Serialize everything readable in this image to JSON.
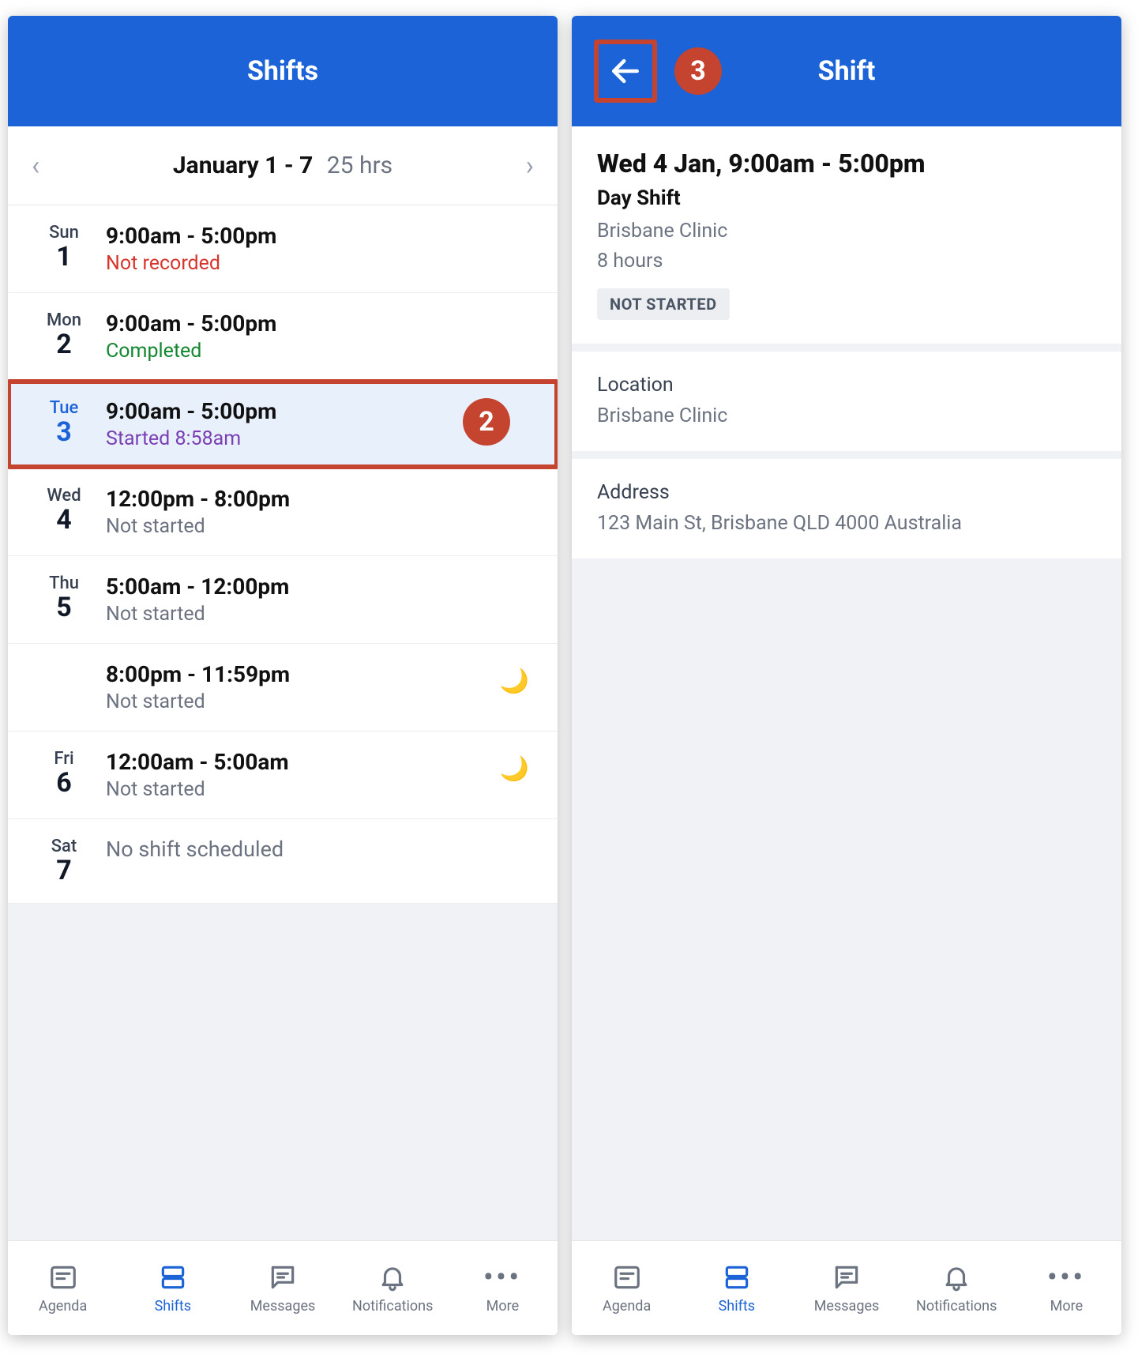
{
  "left": {
    "title": "Shifts",
    "week_range": "January 1 - 7",
    "week_hours": "25 hrs",
    "days": [
      {
        "dow": "Sun",
        "num": "1",
        "time": "9:00am - 5:00pm",
        "status": "Not recorded",
        "status_class": "status-notrecorded"
      },
      {
        "dow": "Mon",
        "num": "2",
        "time": "9:00am - 5:00pm",
        "status": "Completed",
        "status_class": "status-completed"
      },
      {
        "dow": "Tue",
        "num": "3",
        "time": "9:00am - 5:00pm",
        "status": "Started 8:58am",
        "status_class": "status-started",
        "selected": true,
        "callout": "2"
      },
      {
        "dow": "Wed",
        "num": "4",
        "time": "12:00pm - 8:00pm",
        "status": "Not started",
        "status_class": "status-notstarted"
      },
      {
        "dow": "Thu",
        "num": "5",
        "time": "5:00am - 12:00pm",
        "status": "Not started",
        "status_class": "status-notstarted",
        "extra": {
          "time": "8:00pm - 11:59pm",
          "status": "Not started",
          "status_class": "status-notstarted",
          "night": true
        }
      },
      {
        "dow": "Fri",
        "num": "6",
        "time": "12:00am - 5:00am",
        "status": "Not started",
        "status_class": "status-notstarted",
        "night": true
      },
      {
        "dow": "Sat",
        "num": "7",
        "none": "No shift scheduled"
      }
    ]
  },
  "right": {
    "title": "Shift",
    "callout": "3",
    "header": {
      "datetime": "Wed 4 Jan, 9:00am - 5:00pm",
      "name": "Day Shift",
      "location": "Brisbane Clinic",
      "duration": "8 hours",
      "badge": "NOT STARTED"
    },
    "location_section": {
      "label": "Location",
      "value": "Brisbane Clinic"
    },
    "address_section": {
      "label": "Address",
      "value": "123 Main St, Brisbane QLD 4000 Australia"
    }
  },
  "nav": {
    "items": [
      {
        "label": "Agenda",
        "icon": "agenda"
      },
      {
        "label": "Shifts",
        "icon": "shifts",
        "active": true
      },
      {
        "label": "Messages",
        "icon": "messages"
      },
      {
        "label": "Notifications",
        "icon": "bell"
      },
      {
        "label": "More",
        "icon": "more"
      }
    ]
  }
}
